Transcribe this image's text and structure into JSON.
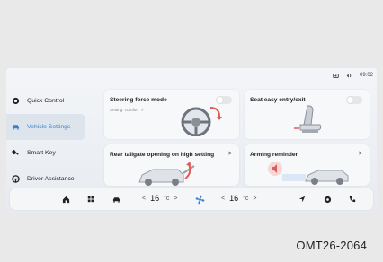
{
  "status_bar": {
    "time": "09:02",
    "icons": [
      "recording-icon",
      "signal-icon"
    ]
  },
  "sidebar": {
    "items": [
      {
        "label": "Quick Control",
        "icon": "quick-control-icon"
      },
      {
        "label": "Vehicle Settings",
        "icon": "car-icon",
        "active": true
      },
      {
        "label": "Smart Key",
        "icon": "key-icon"
      },
      {
        "label": "Driver Assistance",
        "icon": "steering-assist-icon"
      }
    ]
  },
  "cards": {
    "steering": {
      "title": "Steering force mode",
      "subtitle": "Setting: comfort",
      "chevron": ">"
    },
    "seat": {
      "title": "Seat easy entry/exit"
    },
    "tailgate": {
      "title": "Rear tailgate opening on high setting",
      "chevron": ">"
    },
    "arming": {
      "title": "Arming reminder",
      "chevron": ">"
    }
  },
  "dock": {
    "left_temp": {
      "value": "16",
      "dec": "<",
      "unit": "°c",
      "inc": ">"
    },
    "right_temp": {
      "value": "16",
      "dec": "<",
      "unit": "°c",
      "inc": ">"
    },
    "icons": [
      "home-icon",
      "apps-icon",
      "car-icon",
      "fan-icon",
      "navigation-icon",
      "music-icon",
      "phone-icon"
    ],
    "accent": "#3a7fd0"
  },
  "caption": "OMT26-2064"
}
